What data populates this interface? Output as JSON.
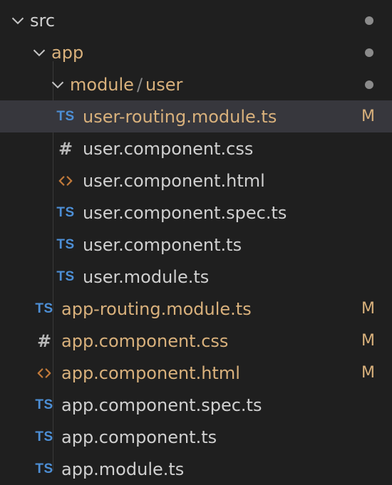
{
  "tree": {
    "src": {
      "label": "src"
    },
    "app": {
      "label": "app"
    },
    "modulePath": {
      "folder": "module",
      "sep": "/",
      "sub": "user"
    },
    "files_user": [
      {
        "name": "user-routing.module.ts",
        "icon": "ts",
        "status": "M",
        "dirty": true,
        "selected": true
      },
      {
        "name": "user.component.css",
        "icon": "hash"
      },
      {
        "name": "user.component.html",
        "icon": "html"
      },
      {
        "name": "user.component.spec.ts",
        "icon": "ts"
      },
      {
        "name": "user.component.ts",
        "icon": "ts"
      },
      {
        "name": "user.module.ts",
        "icon": "ts"
      }
    ],
    "files_app": [
      {
        "name": "app-routing.module.ts",
        "icon": "ts",
        "status": "M",
        "dirty": true
      },
      {
        "name": "app.component.css",
        "icon": "hash",
        "status": "M",
        "dirty": true
      },
      {
        "name": "app.component.html",
        "icon": "html",
        "status": "M",
        "dirty": true
      },
      {
        "name": "app.component.spec.ts",
        "icon": "ts"
      },
      {
        "name": "app.component.ts",
        "icon": "ts"
      },
      {
        "name": "app.module.ts",
        "icon": "ts"
      }
    ],
    "statusLabels": {
      "modified": "M"
    },
    "iconText": {
      "ts": "TS",
      "hash": "#"
    }
  }
}
